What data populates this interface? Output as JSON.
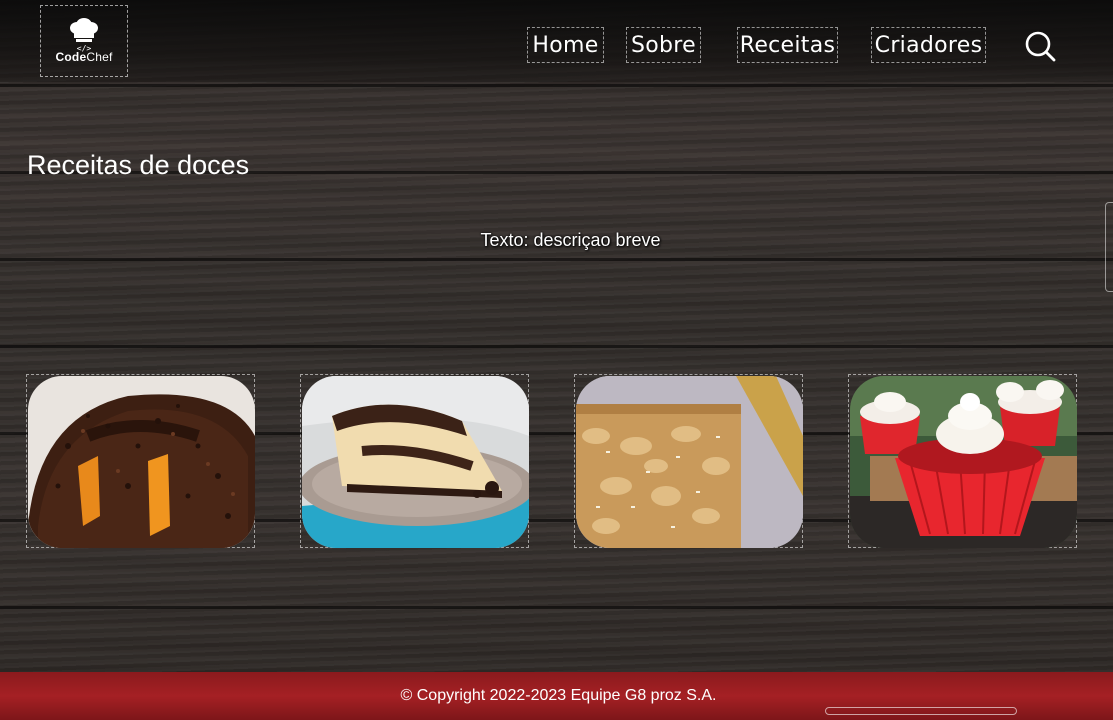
{
  "header": {
    "logo": {
      "brand_bold": "Code",
      "brand_light": "Chef",
      "icon": "chef-hat-icon"
    },
    "nav": [
      {
        "label": "Home"
      },
      {
        "label": "Sobre"
      },
      {
        "label": "Receitas"
      },
      {
        "label": "Criadores"
      }
    ],
    "search_icon": "search-icon"
  },
  "main": {
    "title": "Receitas de doces",
    "description": "Texto: descriçao breve",
    "cards": [
      {
        "subject": "chocolate-carrot-cake"
      },
      {
        "subject": "chocolate-cheesecake-slice"
      },
      {
        "subject": "blondie"
      },
      {
        "subject": "red-velvet-cupcakes"
      }
    ]
  },
  "footer": {
    "copyright": "© Copyright 2022-2023 Equipe G8 proz S.A."
  },
  "colors": {
    "footer_red": "#a52024",
    "header_dark": "#141211",
    "wood": "#3a3431"
  }
}
